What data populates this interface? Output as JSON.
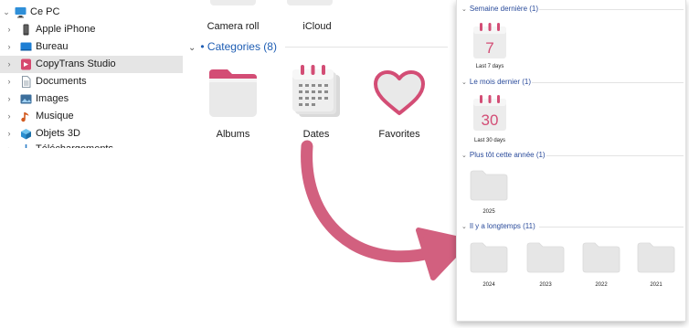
{
  "nav": {
    "items": [
      {
        "label": "Ce PC",
        "icon": "monitor-icon"
      },
      {
        "label": "Apple iPhone",
        "icon": "iphone-icon"
      },
      {
        "label": "Bureau",
        "icon": "desktop-icon"
      },
      {
        "label": "CopyTrans Studio",
        "icon": "copytrans-studio-icon"
      },
      {
        "label": "Documents",
        "icon": "documents-icon"
      },
      {
        "label": "Images",
        "icon": "images-icon"
      },
      {
        "label": "Musique",
        "icon": "music-icon"
      },
      {
        "label": "Objets 3D",
        "icon": "objects-3d-icon"
      },
      {
        "label": "Téléchargements",
        "icon": "downloads-icon"
      }
    ]
  },
  "main": {
    "top_tiles": [
      "Camera roll",
      "iCloud"
    ],
    "categories_header": "• Categories (8)",
    "categories": [
      {
        "label": "Albums",
        "icon": "albums-folder-icon"
      },
      {
        "label": "Dates",
        "icon": "dates-calendar-icon"
      },
      {
        "label": "Favorites",
        "icon": "favorites-heart-icon"
      }
    ]
  },
  "panel": {
    "groups": [
      {
        "header": "Semaine dernière (1)",
        "items": [
          {
            "day": "7",
            "caption": "Last 7 days"
          }
        ]
      },
      {
        "header": "Le mois dernier (1)",
        "items": [
          {
            "day": "30",
            "caption": "Last 30 days"
          }
        ]
      },
      {
        "header": "Plus tôt cette année (1)",
        "items": [
          {
            "caption": "2025"
          }
        ]
      },
      {
        "header": "Il y a longtemps (11)",
        "items": [
          {
            "caption": "2024"
          },
          {
            "caption": "2023"
          },
          {
            "caption": "2022"
          },
          {
            "caption": "2021"
          }
        ]
      }
    ]
  },
  "colors": {
    "accent": "#d05a82",
    "arrow": "#d2607f",
    "link": "#1e5db3",
    "selected_row": "#e5e5e5",
    "folder": "#e6e6e6"
  }
}
